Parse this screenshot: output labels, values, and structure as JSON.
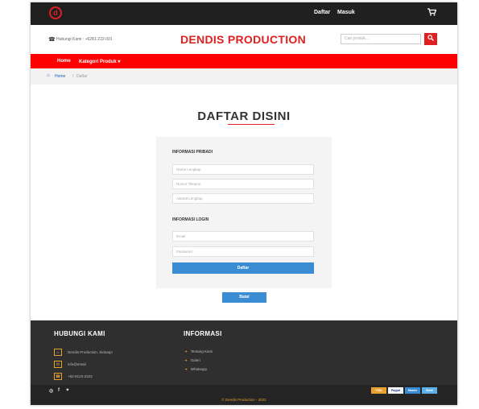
{
  "topbar": {
    "logo": "d",
    "links": [
      "Daftar",
      "Masuk"
    ]
  },
  "header": {
    "hubungi": "Hubungi Kami : +6281-222-001",
    "brand": "DENDIS PRODUCTION",
    "search_placeholder": "Cari produk..."
  },
  "nav": {
    "items": [
      "Home",
      "Kategori Produk"
    ]
  },
  "breadcrumb": {
    "home": "Home",
    "sep": "/",
    "current": "Daftar"
  },
  "main": {
    "title": "DAFTAR DISINI",
    "section_pribadi": "INFORMASI PRIBADI",
    "placeholders_pribadi": [
      "Nama Lengkap",
      "Nomor Telepon",
      "Alamat Lengkap"
    ],
    "section_login": "INFORMASI LOGIN",
    "placeholders_login": [
      "Email",
      "Password"
    ],
    "submit": "Daftar",
    "batal": "Batal"
  },
  "footer": {
    "contact_heading": "HUBUNGI KAMI",
    "contacts": [
      "Dendis Production, Sidoarjo",
      "info@email",
      "+62-8123-2323"
    ],
    "info_heading": "INFORMASI",
    "info_links": [
      "Tentang Kami",
      "Galeri",
      "Whatsapp"
    ],
    "payments": [
      "VISA",
      "Paypal",
      "Master",
      "Bank"
    ],
    "copyright": "© Dendis Production - 2022"
  },
  "colors": {
    "brand_red": "#e02020",
    "nav_red": "#ff0000",
    "button_blue": "#3a8cd3",
    "footer_dark": "#2f2f2f",
    "accent_orange": "#e8a030"
  }
}
